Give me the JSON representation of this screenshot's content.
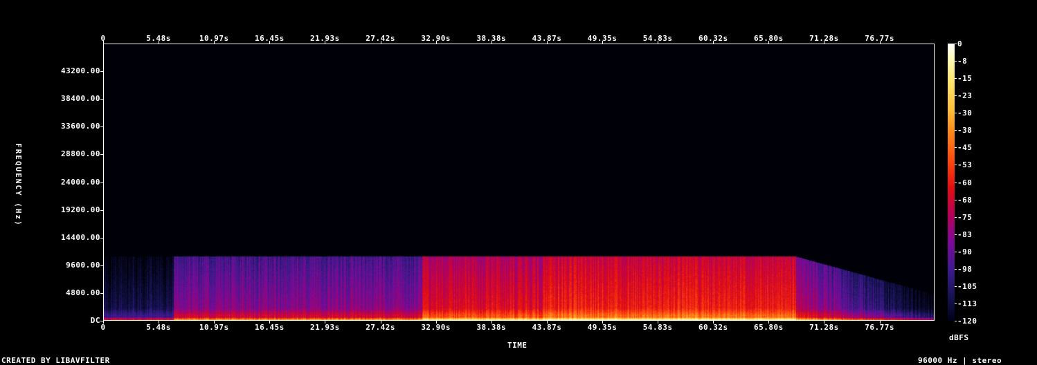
{
  "chart_data": {
    "type": "heatmap",
    "title": "",
    "xlabel": "TIME",
    "ylabel": "FREQUENCY (Hz)",
    "colorbar_label": "dBFS",
    "x_tick_labels": [
      "0",
      "5.48s",
      "10.97s",
      "16.45s",
      "21.93s",
      "27.42s",
      "32.90s",
      "38.38s",
      "43.87s",
      "49.35s",
      "54.83s",
      "60.32s",
      "65.80s",
      "71.28s",
      "76.77s"
    ],
    "x_tick_values": [
      0,
      5.48,
      10.97,
      16.45,
      21.93,
      27.42,
      32.9,
      38.38,
      43.87,
      49.35,
      54.83,
      60.32,
      65.8,
      71.28,
      76.77
    ],
    "xlim": [
      0,
      82.2
    ],
    "y_tick_labels": [
      "DC",
      "4800.00",
      "9600.00",
      "14400.00",
      "19200.00",
      "24000.00",
      "28800.00",
      "33600.00",
      "38400.00",
      "43200.00"
    ],
    "y_tick_values": [
      0,
      4800,
      9600,
      14400,
      19200,
      24000,
      28800,
      33600,
      38400,
      43200
    ],
    "ylim": [
      0,
      48000
    ],
    "colorbar_ticks": [
      "0",
      "-8",
      "-15",
      "-23",
      "-30",
      "-38",
      "-45",
      "-53",
      "-60",
      "-68",
      "-75",
      "-83",
      "-90",
      "-98",
      "-105",
      "-113",
      "-120"
    ],
    "colorbar_range_dbfs": [
      -120,
      0
    ],
    "content_max_frequency_hz": 11000,
    "segments": [
      {
        "t_start": 0,
        "t_end": 6.9,
        "level": "low"
      },
      {
        "t_start": 6.9,
        "t_end": 31.5,
        "level": "medium"
      },
      {
        "t_start": 31.5,
        "t_end": 43.5,
        "level": "high"
      },
      {
        "t_start": 43.5,
        "t_end": 68.5,
        "level": "very-high"
      },
      {
        "t_start": 68.5,
        "t_end": 82.2,
        "level": "fade-out"
      }
    ]
  },
  "footer": {
    "credit": "CREATED BY LIBAVFILTER",
    "format": "96000 Hz | stereo"
  }
}
